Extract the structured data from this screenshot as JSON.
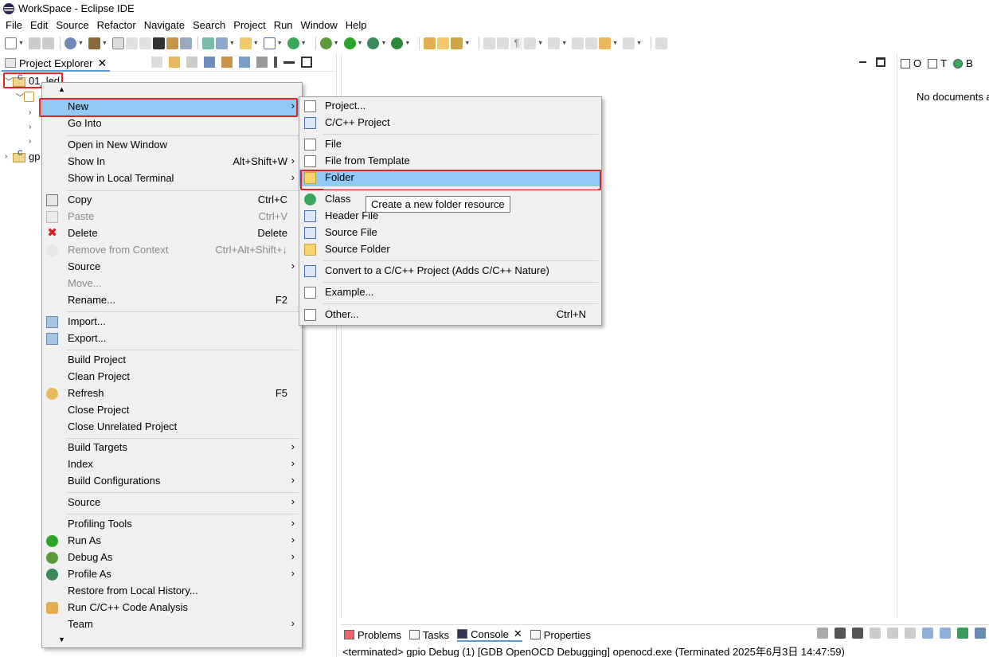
{
  "window": {
    "title": "WorkSpace - Eclipse IDE"
  },
  "menubar": [
    "File",
    "Edit",
    "Source",
    "Refactor",
    "Navigate",
    "Search",
    "Project",
    "Run",
    "Window",
    "Help"
  ],
  "explorer": {
    "tab_label": "Project Explorer",
    "tree": {
      "project1": "01_led",
      "project2": "gp"
    }
  },
  "editor": {},
  "outline": {
    "tabs": [
      "O",
      "T",
      "B"
    ],
    "empty_text": "No documents a"
  },
  "context_menu": {
    "items": [
      {
        "label": "New",
        "shortcut": "",
        "submenu": true
      },
      {
        "label": "Go Into",
        "shortcut": ""
      },
      {
        "label": "Open in New Window",
        "shortcut": ""
      },
      {
        "label": "Show In",
        "shortcut": "Alt+Shift+W",
        "submenu": true
      },
      {
        "label": "Show in Local Terminal",
        "shortcut": "",
        "submenu": true
      },
      {
        "label": "Copy",
        "shortcut": "Ctrl+C"
      },
      {
        "label": "Paste",
        "shortcut": "Ctrl+V"
      },
      {
        "label": "Delete",
        "shortcut": "Delete"
      },
      {
        "label": "Remove from Context",
        "shortcut": "Ctrl+Alt+Shift+↓"
      },
      {
        "label": "Source",
        "shortcut": "",
        "submenu": true
      },
      {
        "label": "Move...",
        "shortcut": ""
      },
      {
        "label": "Rename...",
        "shortcut": "F2"
      },
      {
        "label": "Import...",
        "shortcut": ""
      },
      {
        "label": "Export...",
        "shortcut": ""
      },
      {
        "label": "Build Project",
        "shortcut": ""
      },
      {
        "label": "Clean Project",
        "shortcut": ""
      },
      {
        "label": "Refresh",
        "shortcut": "F5"
      },
      {
        "label": "Close Project",
        "shortcut": ""
      },
      {
        "label": "Close Unrelated Project",
        "shortcut": ""
      },
      {
        "label": "Build Targets",
        "shortcut": "",
        "submenu": true
      },
      {
        "label": "Index",
        "shortcut": "",
        "submenu": true
      },
      {
        "label": "Build Configurations",
        "shortcut": "",
        "submenu": true
      },
      {
        "label": "Source",
        "shortcut": "",
        "submenu": true
      },
      {
        "label": "Profiling Tools",
        "shortcut": "",
        "submenu": true
      },
      {
        "label": "Run As",
        "shortcut": "",
        "submenu": true
      },
      {
        "label": "Debug As",
        "shortcut": "",
        "submenu": true
      },
      {
        "label": "Profile As",
        "shortcut": "",
        "submenu": true
      },
      {
        "label": "Restore from Local History...",
        "shortcut": ""
      },
      {
        "label": "Run C/C++ Code Analysis",
        "shortcut": ""
      },
      {
        "label": "Team",
        "shortcut": "",
        "submenu": true
      }
    ]
  },
  "new_submenu": {
    "items": [
      {
        "label": "Project...",
        "shortcut": ""
      },
      {
        "label": "C/C++ Project",
        "shortcut": ""
      },
      {
        "label": "File",
        "shortcut": ""
      },
      {
        "label": "File from Template",
        "shortcut": ""
      },
      {
        "label": "Folder",
        "shortcut": ""
      },
      {
        "label": "Class",
        "shortcut": ""
      },
      {
        "label": "Header File",
        "shortcut": ""
      },
      {
        "label": "Source File",
        "shortcut": ""
      },
      {
        "label": "Source Folder",
        "shortcut": ""
      },
      {
        "label": "Convert to a C/C++ Project (Adds C/C++ Nature)",
        "shortcut": ""
      },
      {
        "label": "Example...",
        "shortcut": ""
      },
      {
        "label": "Other...",
        "shortcut": "Ctrl+N"
      }
    ]
  },
  "tooltip": "Create a new folder resource",
  "console": {
    "tabs": [
      "Problems",
      "Tasks",
      "Console",
      "Properties"
    ],
    "line": "<terminated> gpio Debug (1) [GDB OpenOCD Debugging] openocd.exe (Terminated 2025年6月3日 14:47:59)"
  },
  "colors": {
    "highlight": "#91c9f7",
    "annotation_red": "#e02424",
    "menu_bg": "#f0f0f0"
  }
}
